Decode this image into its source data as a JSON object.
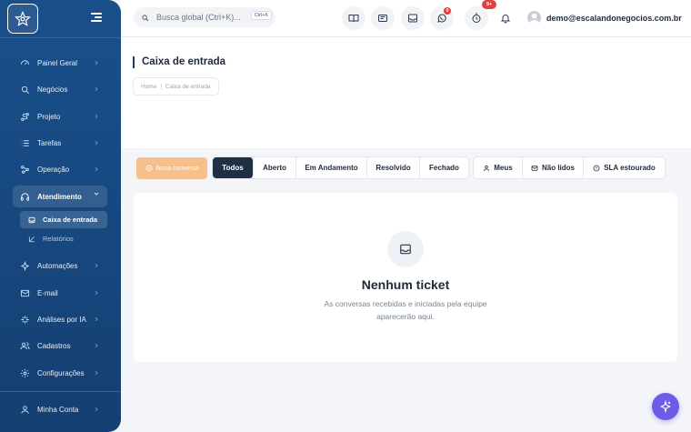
{
  "sidebar": {
    "items": [
      {
        "label": "Painel Geral",
        "icon": "dashboard-icon"
      },
      {
        "label": "Negócios",
        "icon": "search-icon"
      },
      {
        "label": "Projeto",
        "icon": "route-icon"
      },
      {
        "label": "Tarefas",
        "icon": "list-icon"
      },
      {
        "label": "Operação",
        "icon": "network-icon"
      },
      {
        "label": "Atendimento",
        "icon": "headset-icon"
      },
      {
        "label": "Automações",
        "icon": "bolt-icon"
      },
      {
        "label": "E-mail",
        "icon": "mail-icon"
      },
      {
        "label": "Análises por IA",
        "icon": "sparkle-icon"
      },
      {
        "label": "Cadastros",
        "icon": "users-icon"
      },
      {
        "label": "Configurações",
        "icon": "gear-icon"
      }
    ],
    "subitems": [
      {
        "label": "Caixa de entrada",
        "icon": "inbox-icon"
      },
      {
        "label": "Relatórios",
        "icon": "chart-icon"
      }
    ],
    "account": {
      "label": "Minha Conta",
      "icon": "user-icon"
    }
  },
  "topbar": {
    "search_placeholder": "Busca global (Ctrl+K)...",
    "search_shortcut": "Ctrl+K",
    "whatsapp_badge": "0",
    "timer_badge": "9+",
    "user_email": "demo@escalandonegocios.com.br"
  },
  "page": {
    "title": "Caixa de entrada",
    "breadcrumb": [
      "Home",
      "Caixa de entrada"
    ]
  },
  "filters": {
    "new_button": "Nova conversa",
    "status_tabs": [
      "Todos",
      "Aberto",
      "Em Andamento",
      "Resolvido",
      "Fechado"
    ],
    "active_tab": "Todos",
    "extra_tabs": [
      "Meus",
      "Não lidos",
      "SLA estourado"
    ]
  },
  "empty_state": {
    "title": "Nenhum ticket",
    "description": "As conversas recebidas e iniciadas pela equipe aparecerão aqui."
  },
  "colors": {
    "sidebar": "#174a82",
    "active_tab": "#1e2f46",
    "new_button": "#f5c08a",
    "fab": "#6c5ce7",
    "badge": "#e53e3e"
  }
}
